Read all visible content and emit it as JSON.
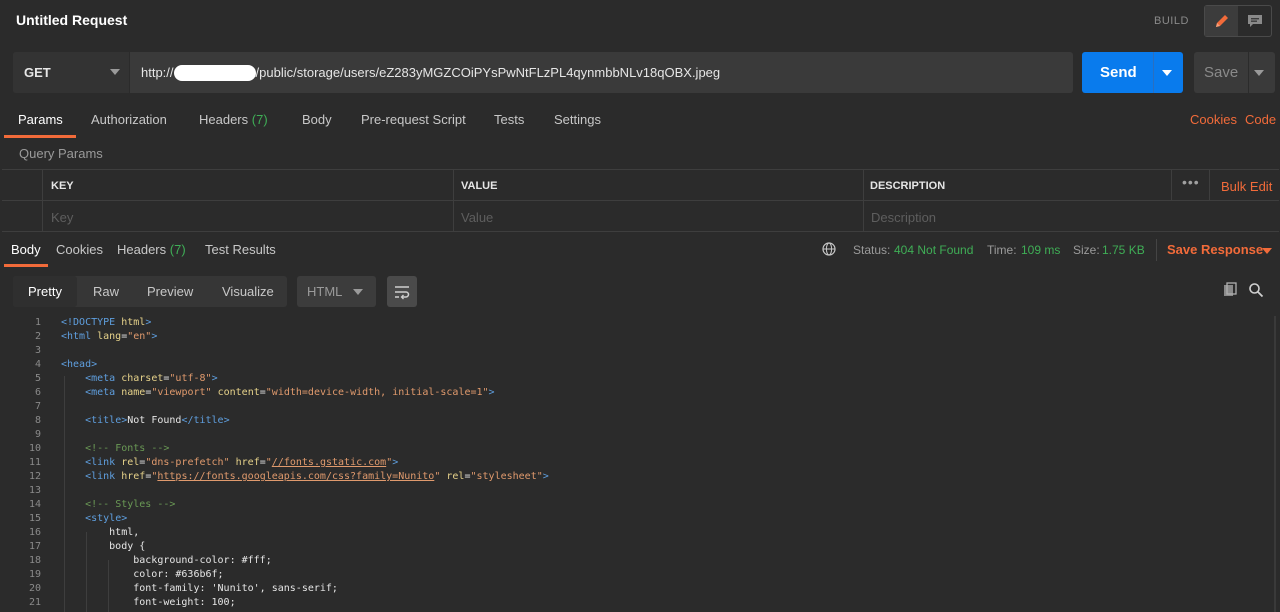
{
  "header": {
    "title": "Untitled Request",
    "build_label": "BUILD",
    "icons": [
      "pencil-icon",
      "comment-icon"
    ]
  },
  "request": {
    "method": "GET",
    "url_prefix": "http://",
    "url_suffix": "/public/storage/users/eZ283yMGZCOiPYsPwNtFLzPL4qynmbbNLv18qOBX.jpeg",
    "send_label": "Send",
    "save_label": "Save"
  },
  "request_tabs": {
    "params": "Params",
    "authorization": "Authorization",
    "headers": "Headers",
    "headers_count": "(7)",
    "body": "Body",
    "prerequest": "Pre-request Script",
    "tests": "Tests",
    "settings": "Settings",
    "cookies": "Cookies",
    "code": "Code"
  },
  "query_params": {
    "label": "Query Params",
    "columns": [
      "KEY",
      "VALUE",
      "DESCRIPTION"
    ],
    "more": "•••",
    "bulk_edit": "Bulk Edit",
    "placeholders": [
      "Key",
      "Value",
      "Description"
    ]
  },
  "response": {
    "tabs": {
      "body": "Body",
      "cookies": "Cookies",
      "headers": "Headers",
      "headers_count": "(7)",
      "test_results": "Test Results"
    },
    "status_label": "Status:",
    "status_value": "404 Not Found",
    "time_label": "Time:",
    "time_value": "109 ms",
    "size_label": "Size:",
    "size_value": "1.75 KB",
    "save_response": "Save Response",
    "view_modes": [
      "Pretty",
      "Raw",
      "Preview",
      "Visualize"
    ],
    "language": "HTML"
  },
  "colors": {
    "accent": "#f26b3a",
    "send": "#097bed",
    "success": "#3fae56",
    "background": "#2b2b2b"
  },
  "code_lines": [
    "1",
    "2",
    "3",
    "4",
    "5",
    "6",
    "7",
    "8",
    "9",
    "10",
    "11",
    "12",
    "13",
    "14",
    "15",
    "16",
    "17",
    "18",
    "19",
    "20",
    "21"
  ]
}
